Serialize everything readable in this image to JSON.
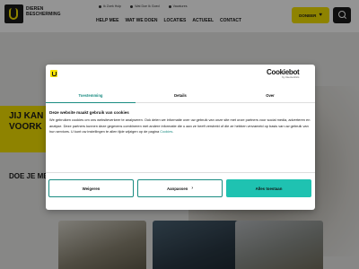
{
  "header": {
    "logo_text_line1": "DIEREN",
    "logo_text_line2": "BESCHERMING",
    "top_links": [
      "Ik Zoek Hulp",
      "Wat Doe Ik Goed",
      "Vacatures"
    ],
    "nav": [
      "HELP MEE",
      "WAT WE DOEN",
      "LOCATIES",
      "ACTUEEL",
      "CONTACT"
    ],
    "donate_label": "DONEER"
  },
  "hero": {
    "title_line1": "JIJ KAN",
    "title_line2": "VOORK",
    "subtitle": "DOE JE ME"
  },
  "cookie_dialog": {
    "brand": "Cookiebot",
    "brand_sub": "by Usercentrics",
    "tabs": [
      "Toestemming",
      "Details",
      "Over"
    ],
    "active_tab": "Toestemming",
    "heading": "Deze website maakt gebruik van cookies",
    "body": "We gebruiken cookies om ons websiteverkeer te analyseren. Ook delen we informatie over uw gebruik van onze site met onze partners voor social media, adverteren en analyse. Deze partners kunnen deze gegevens combineren met andere informatie die u aan ze heeft verstrekt of die ze hebben verzameld op basis van uw gebruik van hun services. U kunt uw instellingen te allen tijde wijzigen op de pagina",
    "link_text": "Cookies",
    "link_suffix": ".",
    "buttons": {
      "deny": "Weigeren",
      "customize": "Aanpassen",
      "allow_all": "Alles toestaan"
    }
  },
  "colors": {
    "brand_yellow": "#f5e200",
    "accent_teal": "#1a8c82",
    "allow_button": "#1fc2b1"
  }
}
